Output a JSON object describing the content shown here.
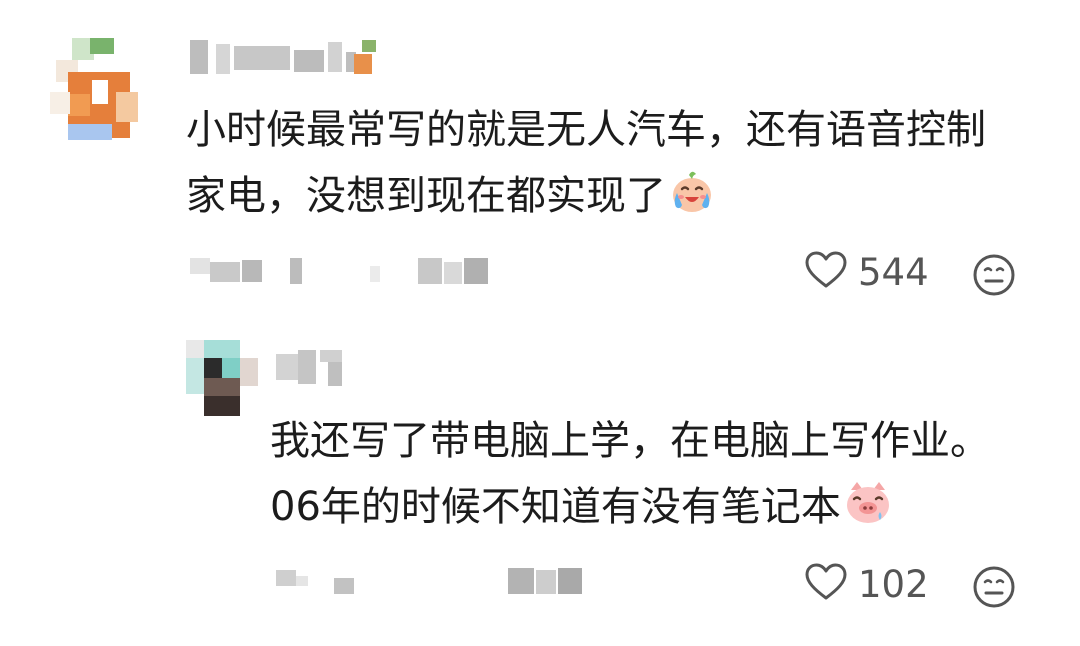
{
  "comments": [
    {
      "text_line1": "小时候最常写的就是无人汽车，还有语音控制",
      "text_line2": "家电，没想到现在都实现了",
      "emoji": "crying-face-emoji",
      "likes": "544"
    },
    {
      "text_line1": "我还写了带电脑上学，在电脑上写作业。",
      "text_line2": "06年的时候不知道有没有笔记本",
      "emoji": "pig-face-emoji",
      "likes": "102"
    }
  ],
  "icons": {
    "like": "heart-outline-icon",
    "reaction": "neutral-face-icon"
  },
  "colors": {
    "text": "#1c1c1c",
    "meta": "#555555",
    "background": "#ffffff"
  }
}
